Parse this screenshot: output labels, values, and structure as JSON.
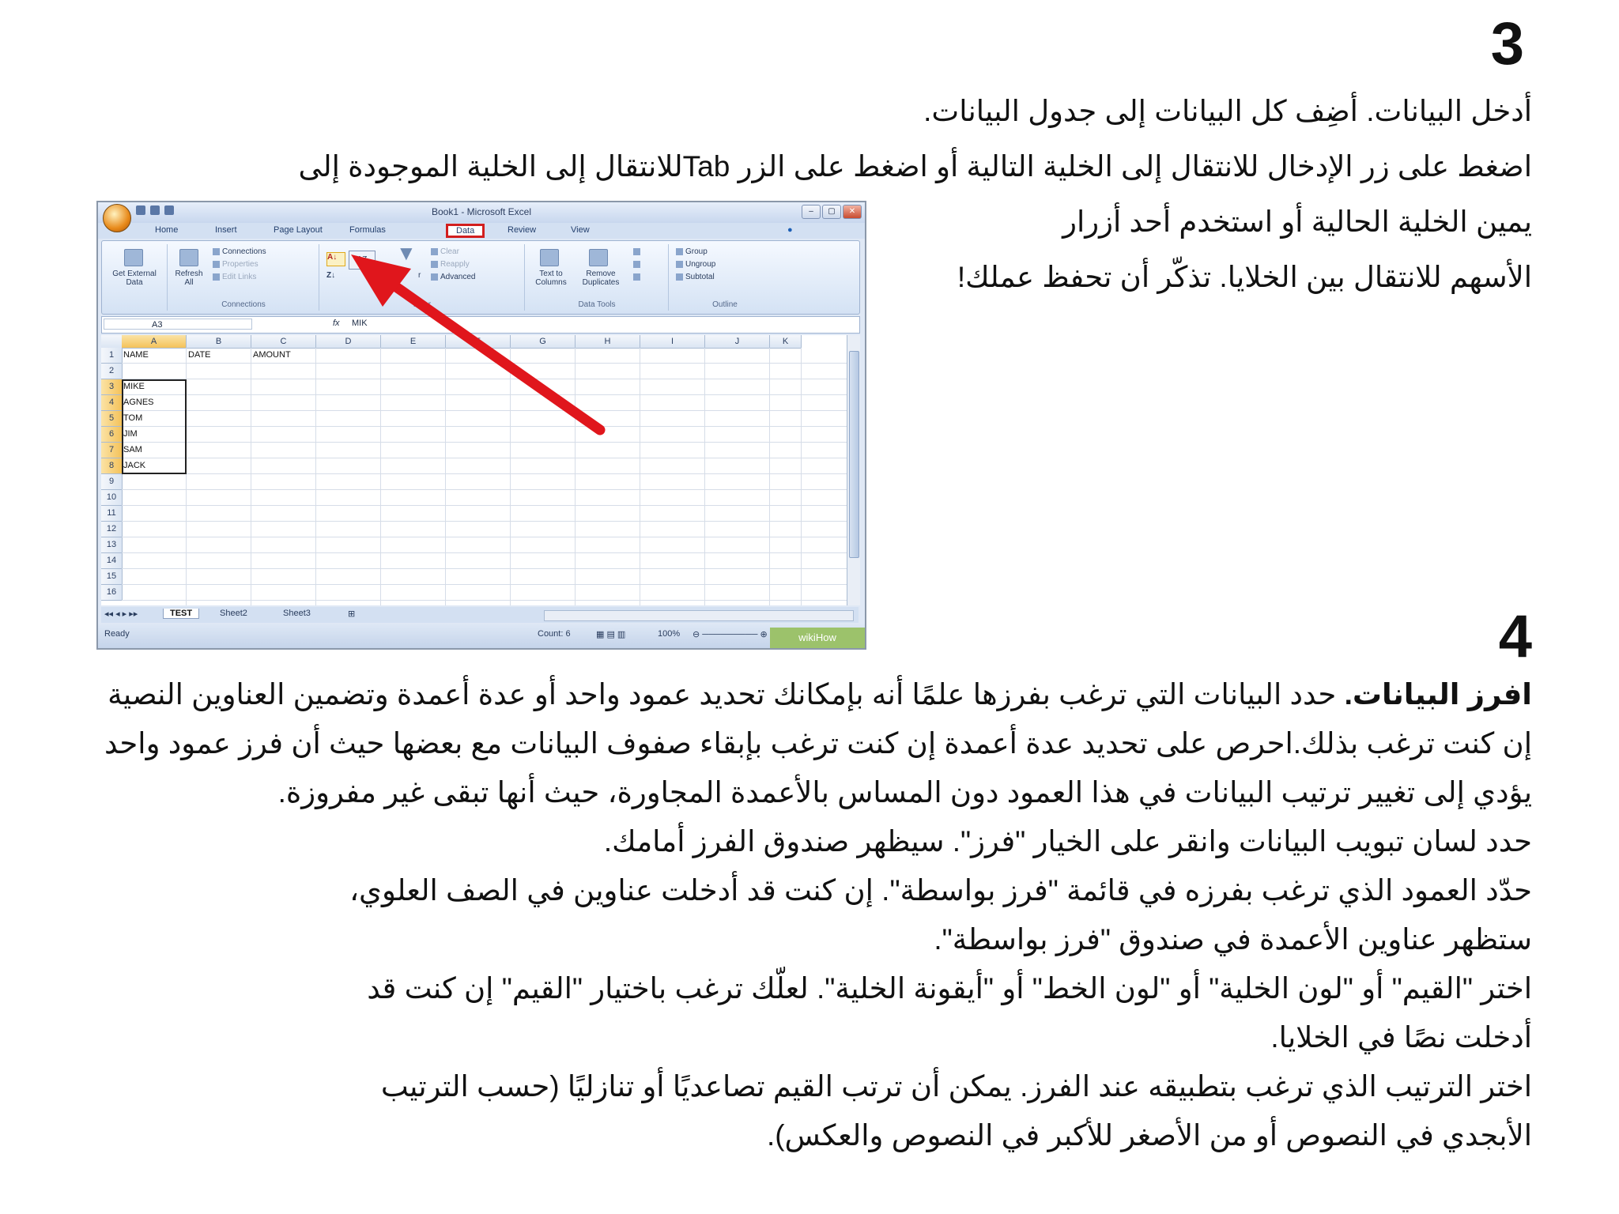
{
  "step3": {
    "number": "3",
    "lines": [
      "أدخل البيانات. أضِف كل البيانات إلى جدول البيانات.",
      "اضغط على زر الإدخال للانتقال إلى الخلية التالية أو اضغط على الزر  Tabللانتقال إلى الخلية الموجودة إلى",
      "يمين الخلية الحالية أو استخدم أحد أزرار",
      "الأسهم للانتقال بين الخلايا. تذكّر أن تحفظ عملك!"
    ]
  },
  "step4": {
    "number": "4",
    "title": "افرز البيانات.",
    "paragraph1": "حدد البيانات التي ترغب بفرزها علمًا أنه بإمكانك تحديد عمود واحد أو عدة أعمدة وتضمين العناوين النصية إن كنت ترغب بذلك.احرص على تحديد عدة أعمدة إن كنت ترغب بإبقاء صفوف البيانات مع بعضها حيث أن فرز عمود واحد يؤدي إلى تغيير ترتيب البيانات في هذا العمود دون المساس بالأعمدة المجاورة، حيث أنها تبقى غير مفروزة.",
    "paragraph2": "حدد لسان تبويب البيانات وانقر على الخيار \"فرز\". سيظهر صندوق الفرز أمامك.",
    "paragraph3": "حدّد العمود الذي ترغب بفرزه في قائمة \"فرز بواسطة\". إن كنت قد أدخلت عناوين في الصف العلوي، ستظهر عناوين الأعمدة في صندوق \"فرز بواسطة\".",
    "paragraph4": "اختر \"القيم\" أو \"لون الخلية\" أو \"لون الخط\" أو \"أيقونة الخلية\". لعلّك ترغب باختيار \"القيم\" إن كنت قد أدخلت نصًا في الخلايا.",
    "paragraph5": "اختر الترتيب الذي ترغب بتطبيقه عند الفرز. يمكن أن ترتب القيم تصاعديًا أو تنازليًا (حسب الترتيب الأبجدي في النصوص أو من الأصغر للأكبر في النصوص والعكس)."
  },
  "excel": {
    "title": "Book1 - Microsoft Excel",
    "tabs": [
      "Home",
      "Insert",
      "Page Layout",
      "Formulas",
      "Data",
      "Review",
      "View"
    ],
    "active_tab": "Data",
    "ribbon": {
      "get_external": "Get External Data",
      "refresh": "Refresh All",
      "connections": "Connections",
      "properties": "Properties",
      "edit_links": "Edit Links",
      "connections_group": "Connections",
      "clear": "Clear",
      "reapply": "Reapply",
      "advanced": "Advanced",
      "filter_partial": "r",
      "filter_group": "Filter",
      "text_to_columns": "Text to Columns",
      "remove_duplicates": "Remove Duplicates",
      "data_tools_group": "Data Tools",
      "group": "Group",
      "ungroup": "Ungroup",
      "subtotal": "Subtotal",
      "outline_group": "Outline"
    },
    "name_box": "A3",
    "formula_value": "MIK",
    "columns": [
      "A",
      "B",
      "C",
      "D",
      "E",
      "F",
      "G",
      "H",
      "I",
      "J",
      "K"
    ],
    "rows": [
      "1",
      "2",
      "3",
      "4",
      "5",
      "6",
      "7",
      "8",
      "9",
      "10",
      "11",
      "12",
      "13",
      "14",
      "15",
      "16"
    ],
    "headers": [
      "NAME",
      "DATE",
      "AMOUNT"
    ],
    "names": [
      "MIKE",
      "AGNES",
      "TOM",
      "JIM",
      "SAM",
      "JACK"
    ],
    "sheets": [
      "TEST",
      "Sheet2",
      "Sheet3"
    ],
    "status_ready": "Ready",
    "status_count": "Count: 6",
    "zoom": "100%",
    "watermark": "wikiHow",
    "colors": {
      "accent_red": "#e0161c",
      "excel_blue": "#dfe8f5"
    }
  }
}
